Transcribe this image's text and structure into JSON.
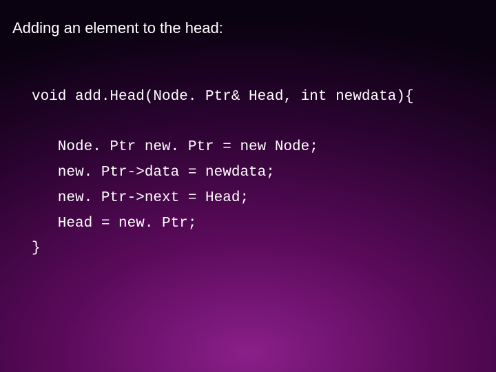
{
  "title": "Adding an element to the head:",
  "code": {
    "line1": "void add.Head(Node. Ptr& Head, int newdata){",
    "line2": "   Node. Ptr new. Ptr = new Node;",
    "line3": "   new. Ptr->data = newdata;",
    "line4": "   new. Ptr->next = Head;",
    "line5": "   Head = new. Ptr;",
    "line6": "}"
  }
}
